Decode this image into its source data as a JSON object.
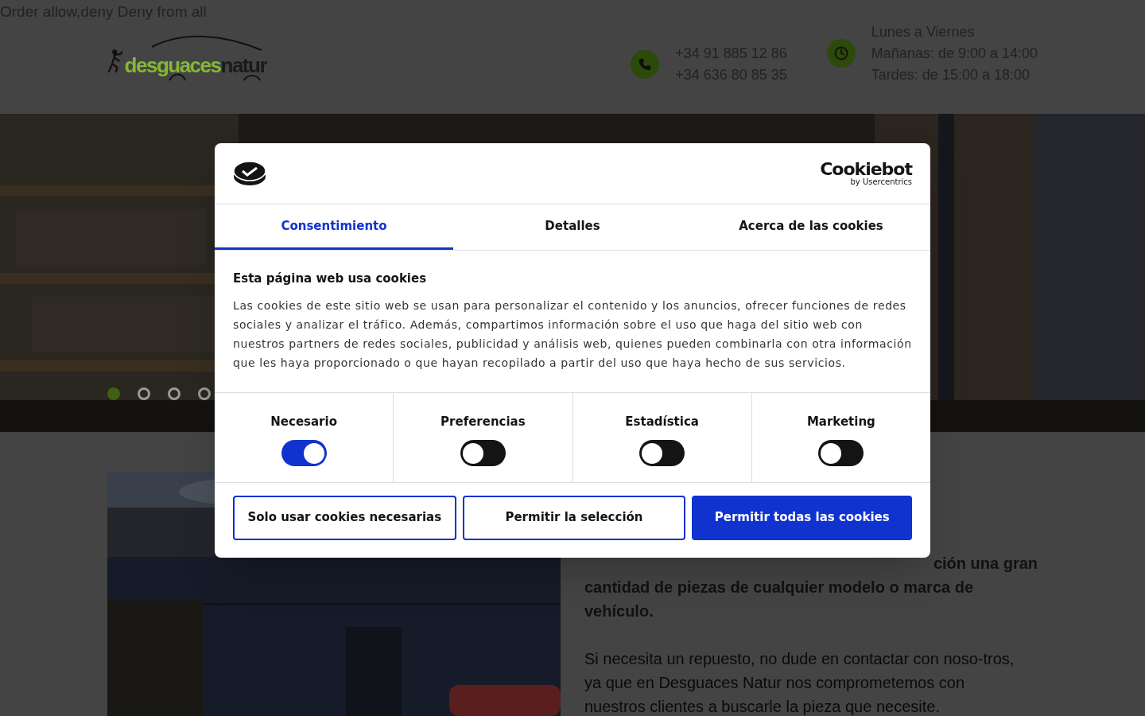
{
  "notice": "Order allow,deny Deny from all",
  "logo": {
    "part_1": "desguaces",
    "part_2": "natur"
  },
  "phones": [
    "+34 91 885 12 86",
    "+34 636 80 85 35"
  ],
  "hours": [
    "Lunes a Viernes",
    "Mañanas: de 9:00 a 14:00",
    "Tardes: de 15:00 a 18:00"
  ],
  "hero": {
    "dots": [
      {
        "selected": true
      },
      {
        "selected": false
      },
      {
        "selected": false
      },
      {
        "selected": false
      }
    ]
  },
  "intro": {
    "lead_line_1": "ción una gran",
    "lead_rest": "cantidad de piezas de cualquier modelo o marca de vehículo.",
    "body": "Si necesita un repuesto, no dude en contactar con noso-tros, ya que en Desguaces Natur nos comprometemos con nuestros clientes a buscarle la pieza que necesite."
  },
  "cookie_dialog": {
    "brand": "Cookiebot",
    "brand_sub": "by Usercentrics",
    "tabs": [
      {
        "label": "Consentimiento",
        "selected": true
      },
      {
        "label": "Detalles",
        "selected": false
      },
      {
        "label": "Acerca de las cookies",
        "selected": false
      }
    ],
    "title": "Esta página web usa cookies",
    "text": "Las cookies de este sitio web se usan para personalizar el contenido y los anuncios, ofrecer funciones de redes sociales y analizar el tráfico. Además, compartimos información sobre el uso que haga del sitio web con nuestros partners de redes sociales, publicidad y análisis web, quienes pueden combinarla con otra información que les haya proporcionado o que hayan recopilado a partir del uso que haya hecho de sus servicios.",
    "categories": [
      {
        "label": "Necesario",
        "on": true
      },
      {
        "label": "Preferencias",
        "on": false
      },
      {
        "label": "Estadística",
        "on": false
      },
      {
        "label": "Marketing",
        "on": false
      }
    ],
    "buttons": [
      {
        "label": "Solo usar cookies necesarias",
        "kind": "outline"
      },
      {
        "label": "Permitir la selección",
        "kind": "outline"
      },
      {
        "label": "Permitir todas las cookies",
        "kind": "primary"
      }
    ]
  }
}
